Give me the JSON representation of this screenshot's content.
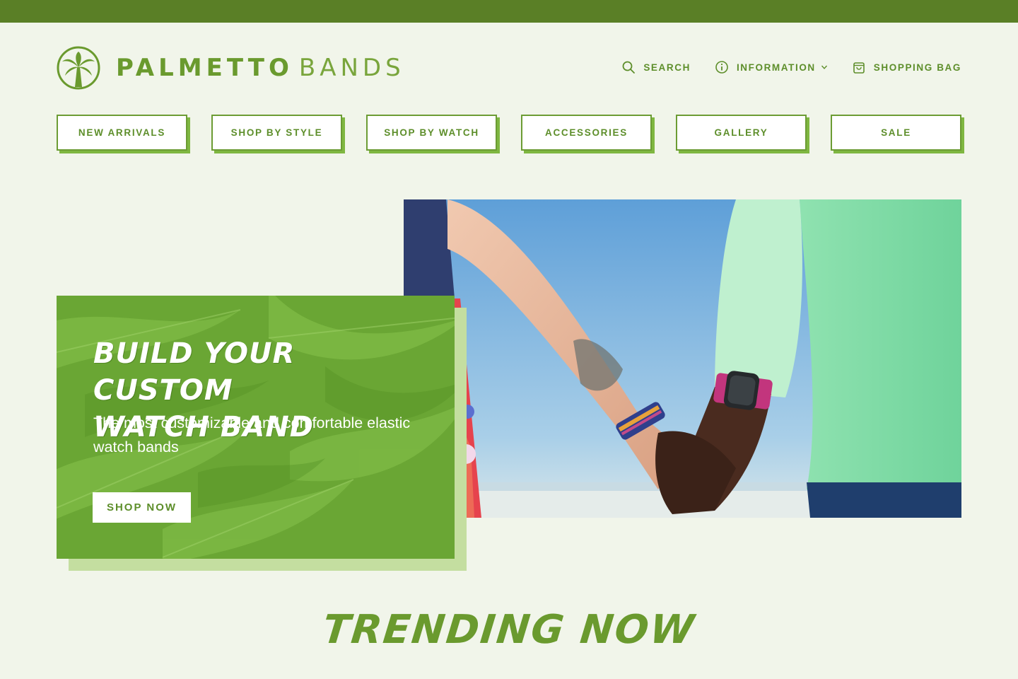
{
  "colors": {
    "top_bar": "#5a7f26",
    "background": "#f1f5ea",
    "brand_green": "#6a9a2e",
    "nav_shadow": "#7fb741",
    "promo_green": "#6aa634",
    "promo_shadow": "#c4dea0"
  },
  "brand": {
    "word1": "PALMETTO",
    "word2": "BANDS",
    "logo_icon": "palm-tree-icon"
  },
  "utility_nav": [
    {
      "label": "SEARCH",
      "icon": "search-icon"
    },
    {
      "label": "INFORMATION",
      "icon": "info-icon",
      "has_dropdown": true
    },
    {
      "label": "SHOPPING BAG",
      "icon": "shopping-bag-icon"
    }
  ],
  "main_nav": [
    {
      "label": "NEW ARRIVALS"
    },
    {
      "label": "SHOP BY STYLE"
    },
    {
      "label": "SHOP BY WATCH"
    },
    {
      "label": "ACCESSORIES"
    },
    {
      "label": "GALLERY"
    },
    {
      "label": "SALE"
    }
  ],
  "hero": {
    "title_line1": "BUILD YOUR CUSTOM",
    "title_line2": "WATCH BAND",
    "subtitle": "The most customizable and comfortable elastic watch bands",
    "cta": "SHOP NOW",
    "image": "photo-holding-hands-watch-band"
  },
  "section_heading": "TRENDING NOW"
}
